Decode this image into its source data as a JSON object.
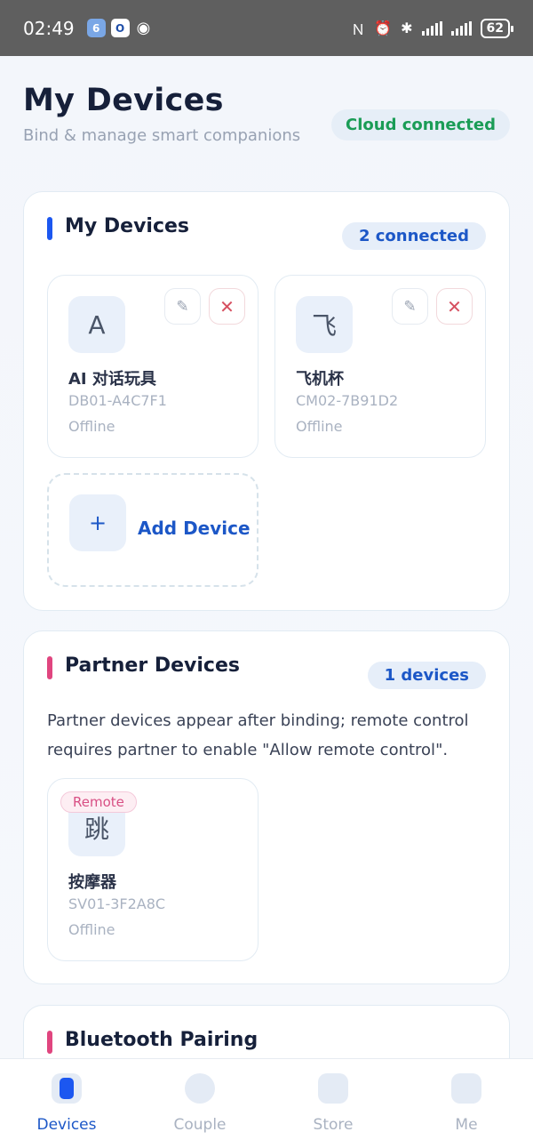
{
  "status_bar": {
    "time": "02:49",
    "badge1": "6",
    "badge2": "O",
    "icons": [
      "nfc-icon",
      "alarm-off-icon",
      "bluetooth-icon",
      "signal-icon",
      "signal-icon"
    ],
    "battery": "62"
  },
  "header": {
    "title": "My Devices",
    "subtitle": "Bind & manage smart companions",
    "cloud_status": "Cloud connected"
  },
  "my_devices": {
    "title": "My Devices",
    "count": "2 connected",
    "accent": "#1c57f0",
    "devices": [
      {
        "avatar": "A",
        "name": "AI 对话玩具",
        "id": "DB01-A4C7F1",
        "status": "Offline"
      },
      {
        "avatar": "飞",
        "name": "飞机杯",
        "id": "CM02-7B91D2",
        "status": "Offline"
      }
    ],
    "add_icon": "+",
    "add_label": "Add Device"
  },
  "partner_devices": {
    "title": "Partner Devices",
    "count": "1 devices",
    "accent": "#e0457f",
    "description": "Partner devices appear after binding; remote control requires partner to enable \"Allow remote control\".",
    "devices": [
      {
        "badge": "Remote",
        "avatar": "跳",
        "name": "按摩器",
        "id": "SV01-3F2A8C",
        "status": "Offline"
      }
    ]
  },
  "bluetooth": {
    "title": "Bluetooth Pairing",
    "accent": "#e0457f"
  },
  "tabs": [
    {
      "label": "Devices",
      "active": true
    },
    {
      "label": "Couple",
      "active": false
    },
    {
      "label": "Store",
      "active": false
    },
    {
      "label": "Me",
      "active": false
    }
  ],
  "icons": {
    "edit": "✎",
    "delete": "✕"
  }
}
